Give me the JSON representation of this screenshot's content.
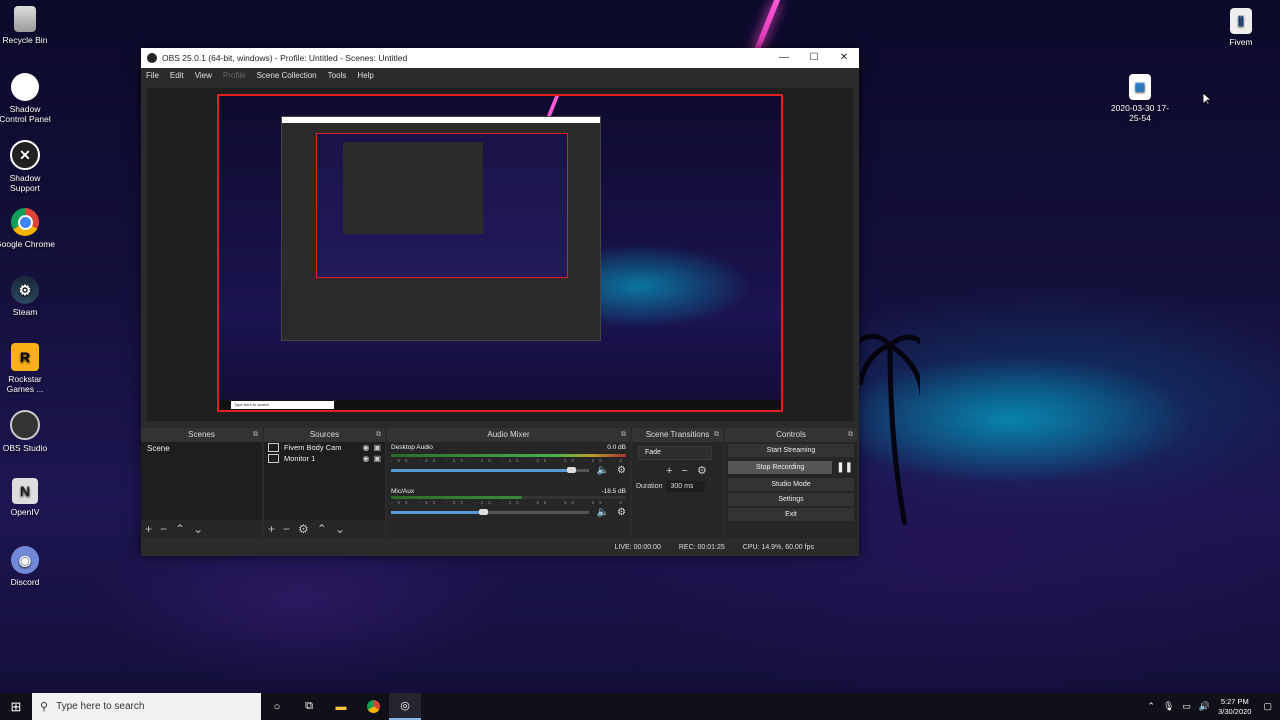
{
  "desktop": {
    "icons_left": [
      {
        "label": "Recycle Bin",
        "icon": "recycle-bin-icon"
      },
      {
        "label": "Shadow Control Panel",
        "icon": "shadow-icon"
      },
      {
        "label": "Shadow Support",
        "icon": "tools-icon"
      },
      {
        "label": "Google Chrome",
        "icon": "chrome-icon"
      },
      {
        "label": "Steam",
        "icon": "steam-icon"
      },
      {
        "label": "Rockstar Games ...",
        "icon": "rockstar-icon"
      },
      {
        "label": "OBS Studio",
        "icon": "obs-icon"
      },
      {
        "label": "OpenIV",
        "icon": "openiv-icon"
      },
      {
        "label": "Discord",
        "icon": "discord-icon"
      }
    ],
    "icons_right": [
      {
        "label": "Fivem",
        "icon": "fivem-icon"
      },
      {
        "label": "2020-03-30 17-25-54",
        "icon": "video-file-icon"
      }
    ]
  },
  "obs": {
    "title": "OBS 25.0.1 (64-bit, windows) - Profile: Untitled - Scenes: Untitled",
    "menu": [
      "File",
      "Edit",
      "View",
      "Profile",
      "Scene Collection",
      "Tools",
      "Help"
    ],
    "docks": {
      "scenes": {
        "title": "Scenes",
        "items": [
          "Scene"
        ]
      },
      "sources": {
        "title": "Sources",
        "items": [
          "Fivem Body Cam",
          "Monitor 1"
        ]
      },
      "mixer": {
        "title": "Audio Mixer",
        "channels": [
          {
            "name": "Desktop Audio",
            "db": "0.0 dB",
            "level": 0.95,
            "volume": 0.88
          },
          {
            "name": "Mic/Aux",
            "db": "-18.5 dB",
            "level": 0.55,
            "volume": 0.45
          }
        ],
        "ticks": "-60 -55 -50 -45 -40 -35 -30 -25 -20 -15 -10 -5 0"
      },
      "transitions": {
        "title": "Scene Transitions",
        "selected": "Fade",
        "duration_label": "Duration",
        "duration": "300 ms"
      },
      "controls": {
        "title": "Controls",
        "buttons": [
          "Start Streaming",
          "Stop Recording",
          "Studio Mode",
          "Settings",
          "Exit"
        ]
      }
    },
    "status": {
      "live": "LIVE: 00:00:00",
      "rec": "REC: 00:01:25",
      "cpu": "CPU: 14.9%, 60.00 fps"
    }
  },
  "taskbar": {
    "search_placeholder": "Type here to search",
    "time": "5:27 PM",
    "date": "3/30/2020"
  }
}
